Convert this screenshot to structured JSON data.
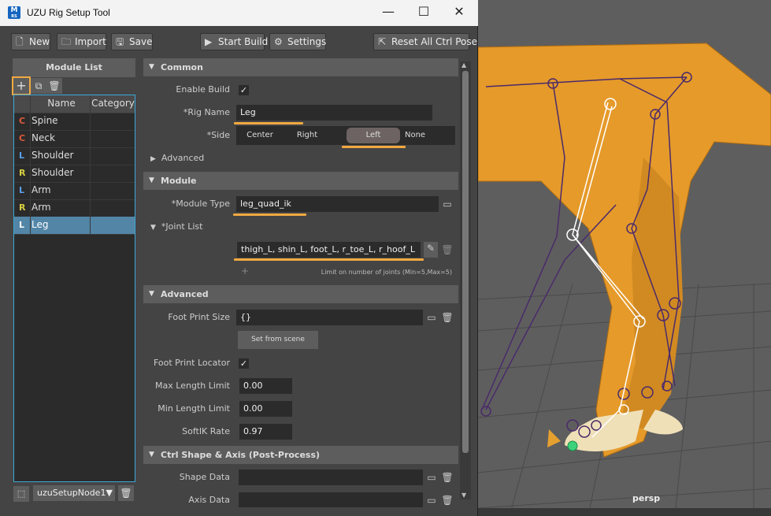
{
  "window": {
    "title": "UZU Rig Setup Tool",
    "app_icon_text": "M",
    "app_icon_sub": "RS",
    "minimize_glyph": "—",
    "maximize_glyph": "☐",
    "close_glyph": "✕"
  },
  "toolbar": {
    "new_label": "New",
    "import_label": "Import",
    "save_label": "Save",
    "start_build_label": "Start Build",
    "settings_label": "Settings",
    "reset_label": "Reset All Ctrl Pose"
  },
  "module_list": {
    "title": "Module List",
    "columns": [
      "Name",
      "Category"
    ],
    "rows": [
      {
        "side": "C",
        "name": "Spine",
        "category": ""
      },
      {
        "side": "C",
        "name": "Neck",
        "category": ""
      },
      {
        "side": "L",
        "name": "Shoulder",
        "category": ""
      },
      {
        "side": "R",
        "name": "Shoulder",
        "category": ""
      },
      {
        "side": "L",
        "name": "Arm",
        "category": ""
      },
      {
        "side": "R",
        "name": "Arm",
        "category": ""
      },
      {
        "side": "L",
        "name": "Leg",
        "category": ""
      }
    ],
    "selected_index": 6,
    "side_colors": {
      "C": "#e05a3a",
      "L": "#5aa0f0",
      "R": "#d8d040"
    },
    "node_select": "uzuSetupNode1"
  },
  "common": {
    "header": "Common",
    "enable_build_label": "Enable Build",
    "enable_build_checked": "✓",
    "rig_name_label": "*Rig Name",
    "rig_name_value": "Leg",
    "side_label": "*Side",
    "side_options": [
      "Center",
      "Right",
      "Left",
      "None"
    ],
    "side_selected": "Left",
    "advanced_label": "Advanced"
  },
  "module": {
    "header": "Module",
    "module_type_label": "*Module Type",
    "module_type_value": "leg_quad_ik",
    "joint_list_header": "*Joint List",
    "joint_list_value": "thigh_L, shin_L, foot_L, r_toe_L, r_hoof_L",
    "joint_limit_note": "Limit on number of joints (Min=5,Max=5)"
  },
  "advanced": {
    "header": "Advanced",
    "foot_print_size_label": "Foot Print Size",
    "foot_print_size_value": "{}",
    "set_from_scene_label": "Set from scene",
    "foot_print_locator_label": "Foot Print Locator",
    "foot_print_locator_checked": "✓",
    "max_length_limit_label": "Max Length Limit",
    "max_length_limit_value": "0.00",
    "min_length_limit_label": "Min Length Limit",
    "min_length_limit_value": "0.00",
    "softik_rate_label": "SoftIK Rate",
    "softik_rate_value": "0.97"
  },
  "ctrl_shape": {
    "header": "Ctrl Shape & Axis (Post-Process)",
    "shape_data_label": "Shape Data",
    "shape_data_value": "",
    "axis_data_label": "Axis Data",
    "axis_data_value": ""
  },
  "viewport": {
    "camera_label": "persp"
  },
  "colors": {
    "highlight": "#f1a940",
    "selection": "#5285a6",
    "panel": "#444444",
    "field": "#2b2b2b"
  }
}
